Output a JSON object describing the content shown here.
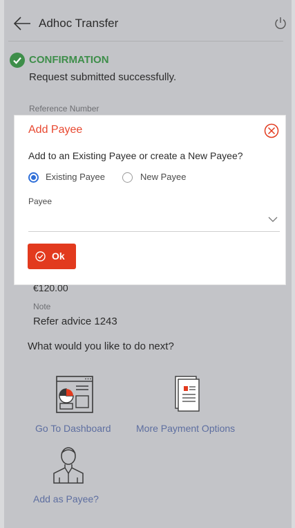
{
  "header": {
    "title": "Adhoc Transfer",
    "back_icon": "arrow-left-icon",
    "power_icon": "power-icon"
  },
  "confirmation": {
    "title": "CONFIRMATION",
    "message": "Request submitted successfully.",
    "reference_label": "Reference Number",
    "amount": "€120.00",
    "note_label": "Note",
    "note_value": "Refer advice 1243"
  },
  "next": {
    "question": "What would you like to do next?",
    "actions": [
      {
        "label": "Go To Dashboard",
        "icon": "dashboard-icon"
      },
      {
        "label": "More Payment Options",
        "icon": "document-icon"
      },
      {
        "label": "Add as Payee?",
        "icon": "person-icon"
      }
    ]
  },
  "modal": {
    "title": "Add Payee",
    "question": "Add to an Existing Payee or create a New Payee?",
    "options": [
      {
        "label": "Existing Payee",
        "selected": true
      },
      {
        "label": "New Payee",
        "selected": false
      }
    ],
    "payee_label": "Payee",
    "payee_value": "",
    "ok_label": "Ok"
  },
  "colors": {
    "accent": "#e23a1e",
    "title_red": "#e8472f",
    "success_green": "#3e8e4a",
    "link_blue": "#5d6ea0",
    "radio_blue": "#2f6fd8",
    "overlay": "#c3c4c8"
  }
}
